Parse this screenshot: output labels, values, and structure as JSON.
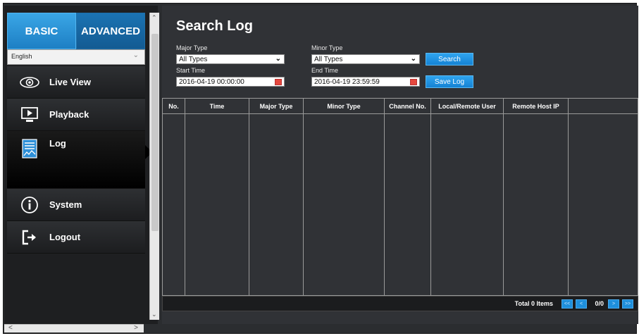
{
  "tabs": {
    "basic": "BASIC",
    "advanced": "ADVANCED"
  },
  "language": {
    "selected": "English"
  },
  "menu": [
    {
      "label": "Live View",
      "icon": "eye-icon"
    },
    {
      "label": "Playback",
      "icon": "playback-icon"
    },
    {
      "label": "Log",
      "icon": "log-icon"
    },
    {
      "label": "System",
      "icon": "info-icon"
    },
    {
      "label": "Logout",
      "icon": "logout-icon"
    }
  ],
  "page": {
    "title": "Search Log"
  },
  "filters": {
    "major_type_label": "Major Type",
    "major_type_value": "All Types",
    "minor_type_label": "Minor Type",
    "minor_type_value": "All Types",
    "start_time_label": "Start Time",
    "start_time_value": "2016-04-19 00:00:00",
    "end_time_label": "End Time",
    "end_time_value": "2016-04-19 23:59:59"
  },
  "buttons": {
    "search": "Search",
    "save_log": "Save Log"
  },
  "table": {
    "columns": [
      "No.",
      "Time",
      "Major Type",
      "Minor Type",
      "Channel No.",
      "Local/Remote User",
      "Remote Host IP",
      ""
    ]
  },
  "pagination": {
    "total": "Total 0 Items",
    "first": "<<",
    "prev": "<",
    "page": "0/0",
    "next": ">",
    "last": ">>"
  },
  "colors": {
    "accent": "#1e8fdc",
    "background": "#303236"
  }
}
